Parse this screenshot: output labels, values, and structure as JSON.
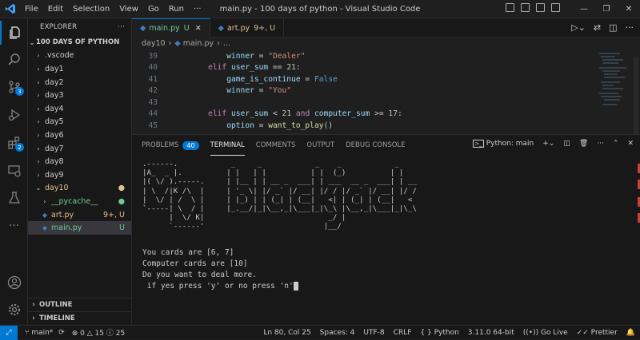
{
  "window": {
    "title": "main.py - 100 days of python - Visual Studio Code"
  },
  "menu": [
    "File",
    "Edit",
    "Selection",
    "View",
    "Go",
    "Run"
  ],
  "menu_more": "···",
  "activity": {
    "scm_badge": "3",
    "ext_badge": "2"
  },
  "explorer": {
    "header": "EXPLORER",
    "more": "···",
    "root": "100 DAYS OF PYTHON",
    "items": [
      {
        "label": ".vscode",
        "chev": "›",
        "color": "#cccccc",
        "status": ""
      },
      {
        "label": "day1",
        "chev": "›",
        "color": "#cccccc",
        "status": ""
      },
      {
        "label": "day2",
        "chev": "›",
        "color": "#cccccc",
        "status": ""
      },
      {
        "label": "day3",
        "chev": "›",
        "color": "#cccccc",
        "status": ""
      },
      {
        "label": "day4",
        "chev": "›",
        "color": "#cccccc",
        "status": ""
      },
      {
        "label": "day5",
        "chev": "›",
        "color": "#cccccc",
        "status": ""
      },
      {
        "label": "day6",
        "chev": "›",
        "color": "#cccccc",
        "status": ""
      },
      {
        "label": "day7",
        "chev": "›",
        "color": "#cccccc",
        "status": ""
      },
      {
        "label": "day8",
        "chev": "›",
        "color": "#cccccc",
        "status": ""
      },
      {
        "label": "day9",
        "chev": "›",
        "color": "#cccccc",
        "status": ""
      },
      {
        "label": "day10",
        "chev": "⌄",
        "color": "#e2c08d",
        "status": "●"
      },
      {
        "label": "__pycache__",
        "chev": "›",
        "color": "#73c991",
        "status": "●"
      },
      {
        "label": "art.py",
        "chev": "",
        "color": "#e2c08d",
        "status": "9+, U"
      },
      {
        "label": "main.py",
        "chev": "",
        "color": "#73c991",
        "status": "U"
      }
    ],
    "outline": "OUTLINE",
    "timeline": "TIMELINE"
  },
  "tabs": [
    {
      "label": "main.py",
      "status": "U",
      "color": "#73c991"
    },
    {
      "label": "art.py",
      "status": "9+, U",
      "color": "#e2c08d"
    }
  ],
  "breadcrumb": [
    "day10",
    "main.py",
    "..."
  ],
  "code": [
    {
      "n": "39",
      "text": "        winner = \"Dealer\""
    },
    {
      "n": "40",
      "text": "    elif user_sum == 21:"
    },
    {
      "n": "41",
      "text": "        game_is_continue = False"
    },
    {
      "n": "42",
      "text": "        winner = \"You\""
    },
    {
      "n": "43",
      "text": ""
    },
    {
      "n": "44",
      "text": "    elif user_sum < 21 and computer_sum >= 17:"
    },
    {
      "n": "45",
      "text": "        option = want_to_play()"
    }
  ],
  "panel": {
    "tabs": [
      "PROBLEMS",
      "TERMINAL",
      "COMMENTS",
      "OUTPUT",
      "DEBUG CONSOLE"
    ],
    "problems_count": "40",
    "active": "TERMINAL",
    "terminal_name": "Python: main"
  },
  "terminal": {
    "art": ".------.            _     _            _    _            _\n|A_  _ |.          | |   | |          | |  (_)          | |\n|( \\/ ).-----.     | |__ | | __ _  ___| | ___  __ _  ___| | __\n| \\  /|K /\\  |     | '_ \\| |/ _` |/ __| |/ / |/ _` |/ __| |/ /\n|  \\/ | /  \\ |     | |_) | | (_| | (__|   <| | (_| | (__|   <\n`-----| \\  / |     |_.__/|_|\\__,_|\\___|_|\\_\\ |\\__,_|\\___|_|\\_\\\n      |  \\/ K|                            _/ |\n      `------'                           |__/",
    "lines": [
      "You cards are [6, 7]",
      "Computer cards are [10]",
      "Do you want to deal more.",
      " if yes press 'y' or no press 'n'"
    ]
  },
  "status": {
    "branch": "main*",
    "errors": "0",
    "warnings": "15",
    "info": "25",
    "position": "Ln 80, Col 25",
    "spaces": "Spaces: 4",
    "encoding": "UTF-8",
    "eol": "CRLF",
    "language": "Python",
    "interpreter": "3.11.0 64-bit",
    "golive": "Go Live",
    "prettier": "Prettier"
  },
  "colors": {
    "accent": "#0078d4",
    "untracked": "#73c991",
    "modified": "#e2c08d"
  }
}
